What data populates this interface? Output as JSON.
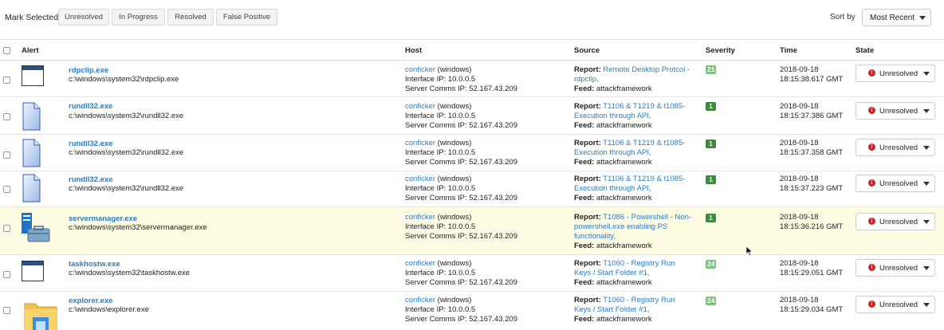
{
  "toolbar": {
    "mark_label": "Mark Selected",
    "buttons": [
      "Unresolved",
      "In Progress",
      "Resolved",
      "False Positive"
    ],
    "sort_label": "Sort by",
    "sort_value": "Most Recent"
  },
  "columns": [
    "Alert",
    "Host",
    "Source",
    "Severity",
    "Time",
    "State"
  ],
  "rows": [
    {
      "icon": "window-icon",
      "name": "rdpclip.exe",
      "path": "c:\\windows\\system32\\rdpclip.exe",
      "host_link": "conficker",
      "host_os": " (windows)",
      "ip": "Interface IP: 10.0.0.5",
      "server": "Server Comms IP: 52.167.43.209",
      "report_label": "Report:",
      "report": "Remote Desktop Protcol - rdpclip,",
      "feed_label": "Feed:",
      "feed": " attackframework",
      "severity": "21",
      "sev_color": "#7fbf7f",
      "date": "2018-09-18",
      "time": "18:15:38.617 GMT",
      "state": "Unresolved",
      "state_icon": "!"
    },
    {
      "icon": "document-icon",
      "name": "rundll32.exe",
      "path": "c:\\windows\\system32\\rundll32.exe",
      "host_link": "conficker",
      "host_os": " (windows)",
      "ip": "Interface IP: 10.0.0.5",
      "server": "Server Comms IP: 52.167.43.209",
      "report_label": "Report:",
      "report": "T1106 & T1219 & t1085- Execution through API,",
      "feed_label": "Feed:",
      "feed": " attackframework",
      "severity": "1",
      "sev_color": "#3d8a3d",
      "date": "2018-09-18",
      "time": "18:15:37.386 GMT",
      "state": "Unresolved",
      "state_icon": "!"
    },
    {
      "icon": "document-icon",
      "name": "rundll32.exe",
      "path": "c:\\windows\\system32\\rundll32.exe",
      "host_link": "conficker",
      "host_os": " (windows)",
      "ip": "Interface IP: 10.0.0.5",
      "server": "Server Comms IP: 52.167.43.209",
      "report_label": "Report:",
      "report": "T1106 & T1219 & t1085- Execution through API,",
      "feed_label": "Feed:",
      "feed": " attackframework",
      "severity": "1",
      "sev_color": "#3d8a3d",
      "date": "2018-09-18",
      "time": "18:15:37.358 GMT",
      "state": "Unresolved",
      "state_icon": "!"
    },
    {
      "icon": "document-icon",
      "name": "rundll32.exe",
      "path": "c:\\windows\\system32\\rundll32.exe",
      "host_link": "conficker",
      "host_os": " (windows)",
      "ip": "Interface IP: 10.0.0.5",
      "server": "Server Comms IP: 52.167.43.209",
      "report_label": "Report:",
      "report": "T1106 & T1219 & t1085- Execution through API,",
      "feed_label": "Feed:",
      "feed": " attackframework",
      "severity": "1",
      "sev_color": "#3d8a3d",
      "date": "2018-09-18",
      "time": "18:15:37.223 GMT",
      "state": "Unresolved",
      "state_icon": "!"
    },
    {
      "icon": "server-manager-icon",
      "name": "servermanager.exe",
      "path": "c:\\windows\\system32\\servermanager.exe",
      "host_link": "conficker",
      "host_os": " (windows)",
      "ip": "Interface IP: 10.0.0.5",
      "server": "Server Comms IP: 52.167.43.209",
      "report_label": "Report:",
      "report": "T1086 - Powershell - Non-powershell.exe enabling PS functionality,",
      "feed_label": "Feed:",
      "feed": " attackframework",
      "severity": "1",
      "sev_color": "#3d8a3d",
      "date": "2018-09-18",
      "time": "18:15:36.216 GMT",
      "state": "Unresolved",
      "state_icon": "!"
    },
    {
      "icon": "window-icon",
      "name": "taskhostw.exe",
      "path": "c:\\windows\\system32\\taskhostw.exe",
      "host_link": "conficker",
      "host_os": " (windows)",
      "ip": "Interface IP: 10.0.0.5",
      "server": "Server Comms IP: 52.167.43.209",
      "report_label": "Report:",
      "report": "T1060 - Registry Run Keys / Start Folder #1,",
      "feed_label": "Feed:",
      "feed": " attackframework",
      "severity": "24",
      "sev_color": "#7fbf7f",
      "date": "2018-09-18",
      "time": "18:15:29.051 GMT",
      "state": "Unresolved",
      "state_icon": "!"
    },
    {
      "icon": "folder-icon",
      "name": "explorer.exe",
      "path": "c:\\windows\\explorer.exe",
      "host_link": "conficker",
      "host_os": " (windows)",
      "ip": "Interface IP: 10.0.0.5",
      "server": "Server Comms IP: 52.167.43.209",
      "report_label": "Report:",
      "report": "T1060 - Registry Run Keys / Start Folder #1,",
      "feed_label": "Feed:",
      "feed": " attackframework",
      "severity": "24",
      "sev_color": "#7fbf7f",
      "date": "2018-09-18",
      "time": "18:15:29.034 GMT",
      "state": "Unresolved",
      "state_icon": "!"
    }
  ],
  "colors": {
    "link": "#2a7dc3",
    "highlight_row": "#fdfce3",
    "unresolved_dot": "#c62828"
  }
}
